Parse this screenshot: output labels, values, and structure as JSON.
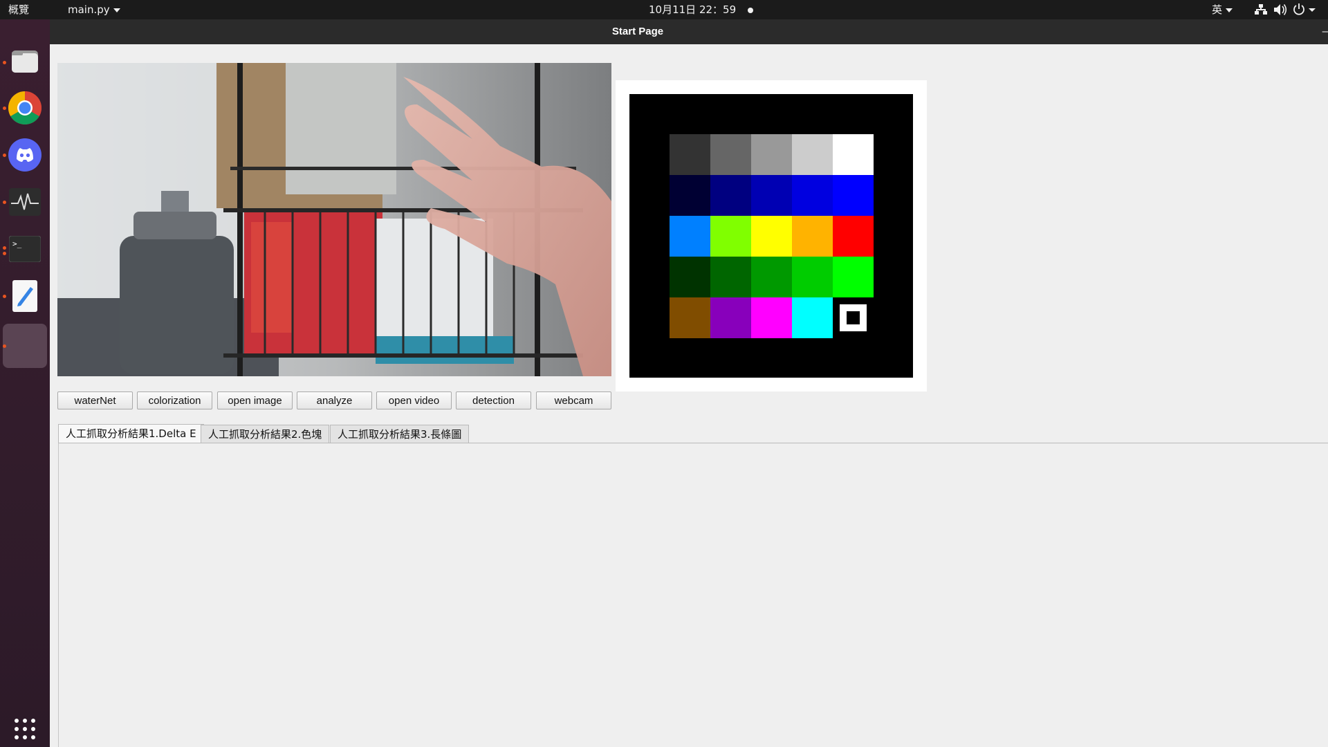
{
  "topbar": {
    "activities": "概覽",
    "app_menu": "main.py",
    "clock": "10月11日  22：59",
    "input_method": "英"
  },
  "dock": {
    "items": [
      "files",
      "chrome",
      "discord",
      "system-monitor",
      "terminal",
      "text-editor",
      "python-app"
    ],
    "show_apps": "show-applications"
  },
  "window": {
    "title": "Start Page",
    "titlebar_button": "–"
  },
  "buttons": [
    "waterNet",
    "colorization",
    "open image",
    "analyze",
    "open video",
    "detection",
    "webcam"
  ],
  "tabs": [
    "人工抓取分析結果1.Delta E",
    "人工抓取分析結果2.色塊",
    "人工抓取分析結果3.長條圖"
  ],
  "color_chart": {
    "rows": [
      [
        "#333333",
        "#666666",
        "#999999",
        "#cccccc",
        "#ffffff"
      ],
      [
        "#000033",
        "#000080",
        "#0000b3",
        "#0000e0",
        "#0000ff"
      ],
      [
        "#0080ff",
        "#80ff00",
        "#ffff00",
        "#ffb300",
        "#ff0000"
      ],
      [
        "#003300",
        "#006600",
        "#009900",
        "#00cc00",
        "#00ff00"
      ],
      [
        "#804d00",
        "#8800bb",
        "#ff00ff",
        "#00ffff",
        "marker"
      ]
    ]
  },
  "colors": {
    "accent": "#e95420",
    "topbar": "#1b1b1b",
    "titlebar": "#2b2b2b",
    "window_bg": "#efefef"
  }
}
